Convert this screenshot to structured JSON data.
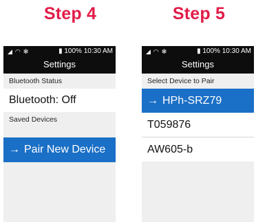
{
  "steps": [
    {
      "title": "Step 4",
      "status": {
        "battery_icon": "battery-icon",
        "battery": "100%",
        "time": "10:30 AM"
      },
      "header_title": "Settings",
      "sections": [
        {
          "label": "Bluetooth Status"
        },
        {
          "label": "Saved Devices"
        }
      ],
      "rows": [
        {
          "label": "Bluetooth: Off",
          "selected": false
        },
        {
          "label": "Pair New Device",
          "selected": true,
          "prefix": "→"
        }
      ]
    },
    {
      "title": "Step 5",
      "status": {
        "battery_icon": "battery-icon",
        "battery": "100%",
        "time": "10:30 AM"
      },
      "header_title": "Settings",
      "section_label": "Select Device to Pair",
      "devices": [
        {
          "label": "HPh-SRZ79",
          "selected": true,
          "prefix": "→"
        },
        {
          "label": "T059876",
          "selected": false
        },
        {
          "label": "AW605-b",
          "selected": false
        }
      ]
    }
  ],
  "colors": {
    "accent": "#e11d48",
    "selected_row": "#1a6fc6",
    "statusbar": "#0d0d0d"
  }
}
